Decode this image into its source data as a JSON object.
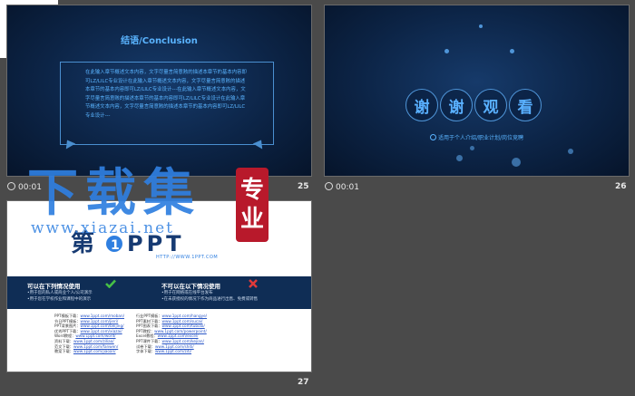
{
  "slides": [
    {
      "number": "25",
      "timing": "00:01",
      "title": "结语/Conclusion",
      "body": "在此输入章节概述文本内容，文字尽量言简意赅的描述本章节的基本内容即可LZ/LILC专业设计在此输入章节概述文本内容，文字尽量言简意赅的描述本章节的基本内容即可LZ/LILC专业设计---在此输入章节概述文本内容，文字尽量言简意赅的描述本章节的基本内容即可LZ/LILC专业设计在此输入章节概述文本内容，文字尽量言简意赅的描述本章节的基本内容即可LZ/LILC专业设计---"
    },
    {
      "number": "26",
      "timing": "00:01",
      "thanks_chars": [
        "谢",
        "谢",
        "观",
        "看"
      ],
      "caption": "适用于个人介绍/职业计划/岗位竞聘"
    },
    {
      "number": "27",
      "brand_url": "HTTP://WWW.1PPT.COM",
      "can_use_heading": "可以在下列情况使用",
      "can_use_lines": [
        "•用于您的私人或商业个人/公司演示",
        "•用于您在学校作业和课程中的演示"
      ],
      "cannot_use_heading": "不可以在以下情况使用",
      "cannot_use_lines": [
        "•用于在网络或在线平台发布",
        "•在未获授权的情况下作为商品进行出售、免费或转售"
      ],
      "links_left": [
        {
          "label": "PPT模板下载：",
          "url": "www.1ppt.com/moban/"
        },
        {
          "label": "节日PPT模板：",
          "url": "www.1ppt.com/jieri/"
        },
        {
          "label": "PPT背景图片：",
          "url": "www.1ppt.com/beijing/"
        },
        {
          "label": "优秀PPT下载：",
          "url": "www.1ppt.com/xiazai/"
        },
        {
          "label": "Word教程：",
          "url": "www.1ppt.com/word/"
        },
        {
          "label": "资料下载：",
          "url": "www.1ppt.com/ziliao/"
        },
        {
          "label": "范文下载：",
          "url": "www.1ppt.com/fanwen/"
        },
        {
          "label": "教案下载：",
          "url": "www.1ppt.com/jiaoan/"
        }
      ],
      "links_right": [
        {
          "label": "行业PPT模板：",
          "url": "www.1ppt.com/hangye/"
        },
        {
          "label": "PPT素材下载：",
          "url": "www.1ppt.com/sucai/"
        },
        {
          "label": "PPT图表下载：",
          "url": "www.1ppt.com/tubiao/"
        },
        {
          "label": "PPT教程：",
          "url": "www.1ppt.com/powerpoint/"
        },
        {
          "label": "Excel教程：",
          "url": "www.1ppt.com/excel/"
        },
        {
          "label": "PPT课件下载：",
          "url": "www.1ppt.com/kejian/"
        },
        {
          "label": "试卷下载：",
          "url": "www.1ppt.com/shiti/"
        },
        {
          "label": "字体下载：",
          "url": "www.1ppt.com/ziti/"
        }
      ]
    }
  ],
  "watermark": {
    "title": "下载集",
    "seal": [
      "专",
      "业"
    ],
    "url": "www.xiazai.net"
  },
  "colors": {
    "accent_blue": "#5ab4ff",
    "watermark_blue": "#2f7fe0",
    "seal_red": "#b8192b",
    "band_navy": "#0f2d55"
  },
  "icons": [
    "clock-icon",
    "check-icon",
    "cross-icon",
    "radio-dot-icon"
  ]
}
